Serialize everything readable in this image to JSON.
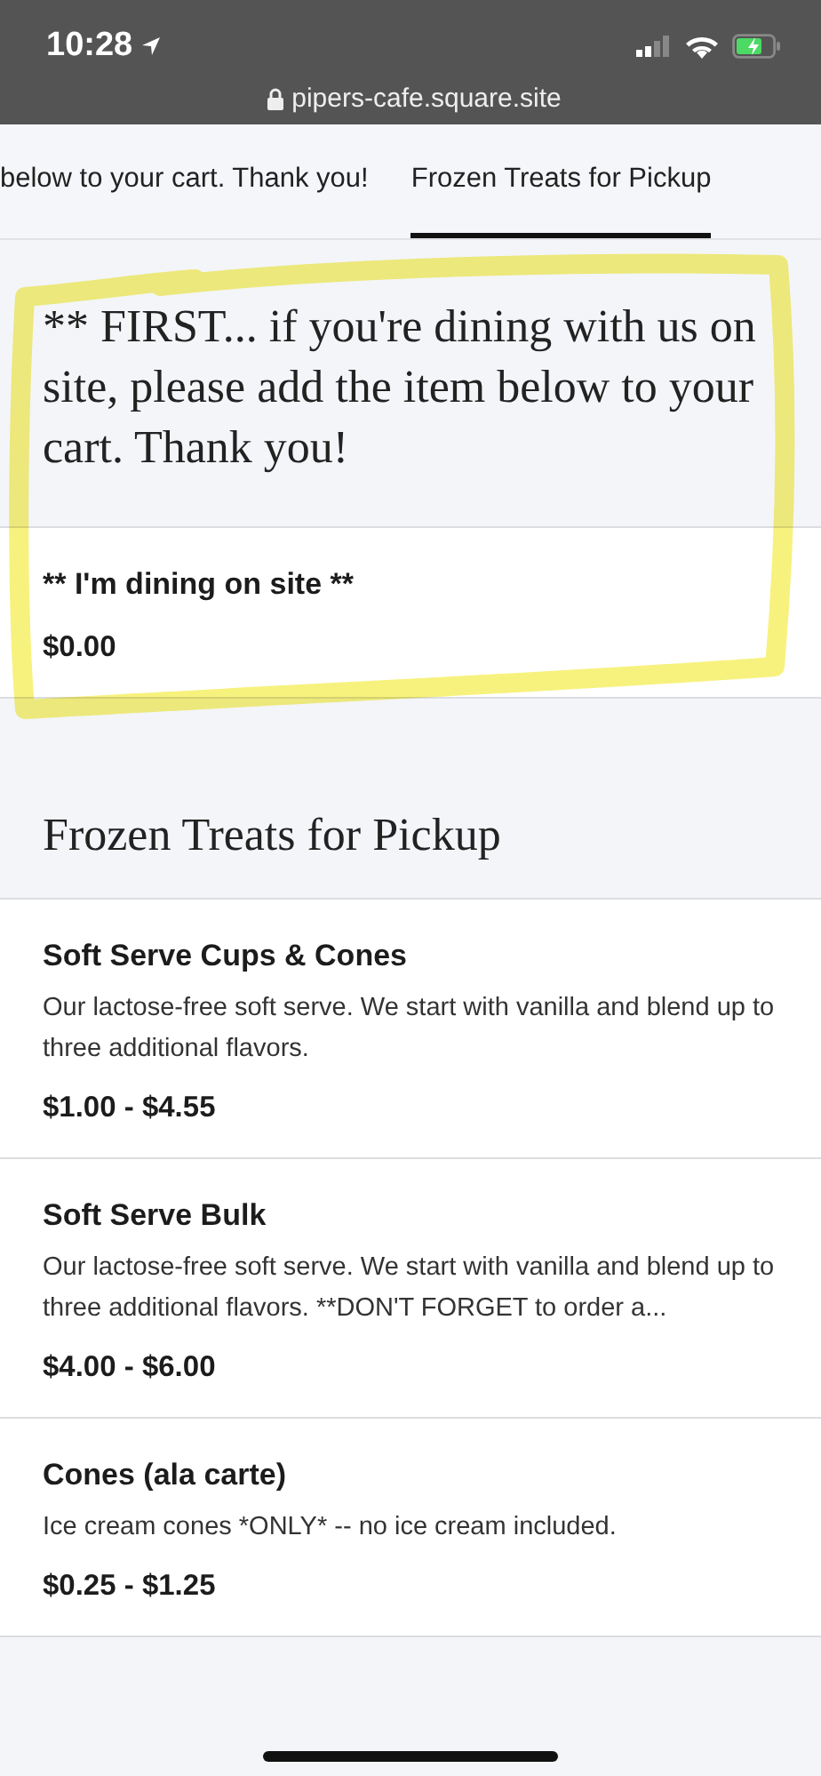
{
  "status_bar": {
    "time": "10:28",
    "url": "pipers-cafe.square.site"
  },
  "tabs": [
    {
      "label": "below to your cart. Thank you!",
      "selected": false
    },
    {
      "label": "Frozen Treats for Pickup",
      "selected": true
    }
  ],
  "sections": [
    {
      "heading": "** FIRST... if you're dining with us on site, please add the item below to your cart. Thank you!",
      "highlighted": true,
      "items": [
        {
          "name": "** I'm dining on site **",
          "price": "$0.00"
        }
      ]
    },
    {
      "heading": "Frozen Treats for Pickup",
      "items": [
        {
          "name": "Soft Serve Cups & Cones",
          "description": "Our lactose-free soft serve. We start with vanilla and blend up to three additional flavors.",
          "price": "$1.00 - $4.55"
        },
        {
          "name": "Soft Serve Bulk",
          "description": "Our lactose-free soft serve. We start with vanilla and blend up to three additional flavors. **DON'T FORGET to order a...",
          "price": "$4.00 - $6.00"
        },
        {
          "name": "Cones (ala carte)",
          "description": "Ice cream cones *ONLY* -- no ice cream included.",
          "price": "$0.25 - $1.25"
        }
      ]
    }
  ]
}
